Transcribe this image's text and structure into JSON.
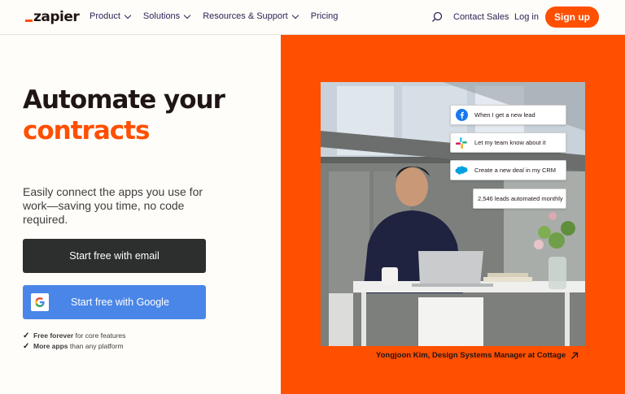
{
  "brand": {
    "logo_text": "zapier",
    "accent": "#ff4f00"
  },
  "nav": {
    "items": [
      {
        "label": "Product"
      },
      {
        "label": "Solutions"
      },
      {
        "label": "Resources & Support"
      },
      {
        "label": "Pricing"
      }
    ],
    "contact_sales": "Contact Sales",
    "log_in": "Log in",
    "sign_up": "Sign up"
  },
  "hero": {
    "title_line1": "Automate your",
    "title_line2": "contracts",
    "description": "Easily connect the apps you use for work—saving you time, no code required.",
    "btn_email": "Start free with email",
    "btn_google": "Start free with Google",
    "perks": [
      {
        "bold": "Free forever",
        "rest": " for core features"
      },
      {
        "bold": "More apps",
        "rest": " than any platform"
      }
    ]
  },
  "visual": {
    "cards": [
      {
        "icon": "facebook-icon",
        "text": "When I get a new lead"
      },
      {
        "icon": "slack-icon",
        "text": "Let my team know about it"
      },
      {
        "icon": "salesforce-icon",
        "text": "Create a new deal in my CRM"
      },
      {
        "icon": "",
        "text": "2,546 leads automated monthly"
      }
    ],
    "caption": "Yongjoon Kim, Design Systems Manager at Cottage"
  }
}
